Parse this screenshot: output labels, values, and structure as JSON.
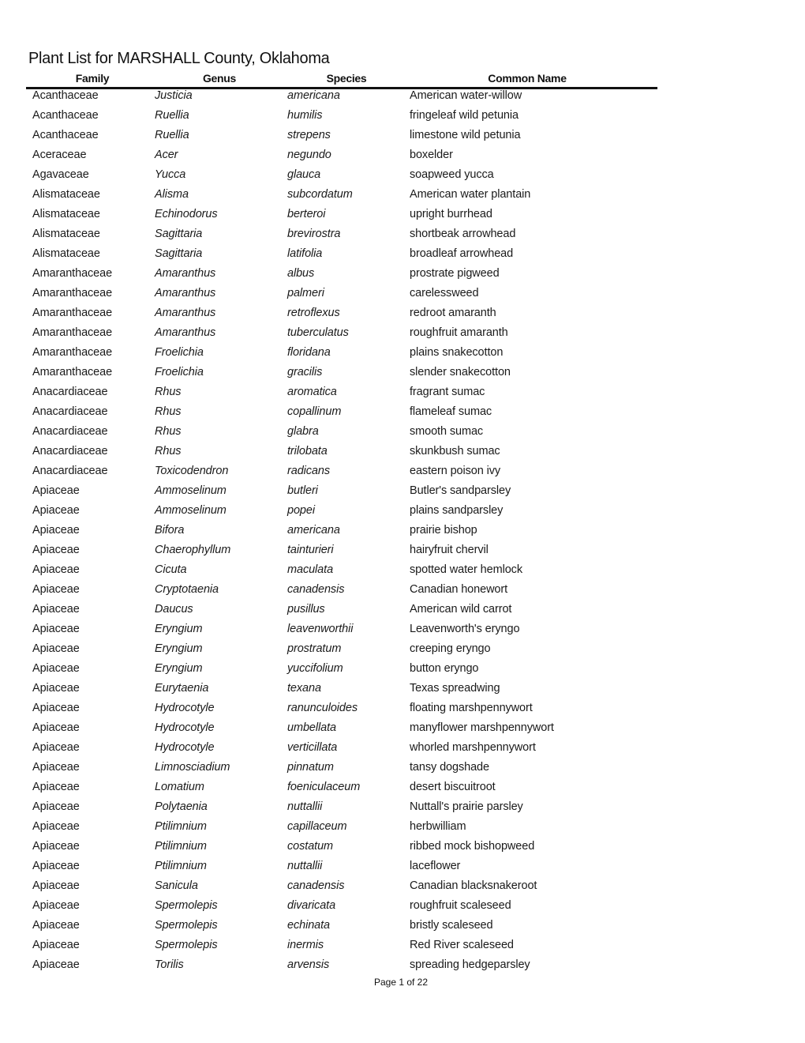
{
  "document": {
    "title": "Plant List for MARSHALL County, Oklahoma",
    "columns": {
      "family": "Family",
      "genus": "Genus",
      "species": "Species",
      "common_name": "Common Name"
    },
    "rows": [
      {
        "family": "Acanthaceae",
        "genus": "Justicia",
        "species": "americana",
        "common_name": "American water-willow"
      },
      {
        "family": "Acanthaceae",
        "genus": "Ruellia",
        "species": "humilis",
        "common_name": "fringeleaf wild petunia"
      },
      {
        "family": "Acanthaceae",
        "genus": "Ruellia",
        "species": "strepens",
        "common_name": "limestone wild petunia"
      },
      {
        "family": "Aceraceae",
        "genus": "Acer",
        "species": "negundo",
        "common_name": "boxelder"
      },
      {
        "family": "Agavaceae",
        "genus": "Yucca",
        "species": "glauca",
        "common_name": "soapweed yucca"
      },
      {
        "family": "Alismataceae",
        "genus": "Alisma",
        "species": "subcordatum",
        "common_name": "American water plantain"
      },
      {
        "family": "Alismataceae",
        "genus": "Echinodorus",
        "species": "berteroi",
        "common_name": "upright burrhead"
      },
      {
        "family": "Alismataceae",
        "genus": "Sagittaria",
        "species": "brevirostra",
        "common_name": "shortbeak arrowhead"
      },
      {
        "family": "Alismataceae",
        "genus": "Sagittaria",
        "species": "latifolia",
        "common_name": "broadleaf arrowhead"
      },
      {
        "family": "Amaranthaceae",
        "genus": "Amaranthus",
        "species": "albus",
        "common_name": "prostrate pigweed"
      },
      {
        "family": "Amaranthaceae",
        "genus": "Amaranthus",
        "species": "palmeri",
        "common_name": "carelessweed"
      },
      {
        "family": "Amaranthaceae",
        "genus": "Amaranthus",
        "species": "retroflexus",
        "common_name": "redroot amaranth"
      },
      {
        "family": "Amaranthaceae",
        "genus": "Amaranthus",
        "species": "tuberculatus",
        "common_name": "roughfruit amaranth"
      },
      {
        "family": "Amaranthaceae",
        "genus": "Froelichia",
        "species": "floridana",
        "common_name": "plains snakecotton"
      },
      {
        "family": "Amaranthaceae",
        "genus": "Froelichia",
        "species": "gracilis",
        "common_name": "slender snakecotton"
      },
      {
        "family": "Anacardiaceae",
        "genus": "Rhus",
        "species": "aromatica",
        "common_name": "fragrant sumac"
      },
      {
        "family": "Anacardiaceae",
        "genus": "Rhus",
        "species": "copallinum",
        "common_name": "flameleaf sumac"
      },
      {
        "family": "Anacardiaceae",
        "genus": "Rhus",
        "species": "glabra",
        "common_name": "smooth sumac"
      },
      {
        "family": "Anacardiaceae",
        "genus": "Rhus",
        "species": "trilobata",
        "common_name": "skunkbush sumac"
      },
      {
        "family": "Anacardiaceae",
        "genus": "Toxicodendron",
        "species": "radicans",
        "common_name": "eastern poison ivy"
      },
      {
        "family": "Apiaceae",
        "genus": "Ammoselinum",
        "species": "butleri",
        "common_name": "Butler's sandparsley"
      },
      {
        "family": "Apiaceae",
        "genus": "Ammoselinum",
        "species": "popei",
        "common_name": "plains sandparsley"
      },
      {
        "family": "Apiaceae",
        "genus": "Bifora",
        "species": "americana",
        "common_name": "prairie bishop"
      },
      {
        "family": "Apiaceae",
        "genus": "Chaerophyllum",
        "species": "tainturieri",
        "common_name": "hairyfruit chervil"
      },
      {
        "family": "Apiaceae",
        "genus": "Cicuta",
        "species": "maculata",
        "common_name": "spotted water hemlock"
      },
      {
        "family": "Apiaceae",
        "genus": "Cryptotaenia",
        "species": "canadensis",
        "common_name": "Canadian honewort"
      },
      {
        "family": "Apiaceae",
        "genus": "Daucus",
        "species": "pusillus",
        "common_name": "American wild carrot"
      },
      {
        "family": "Apiaceae",
        "genus": "Eryngium",
        "species": "leavenworthii",
        "common_name": "Leavenworth's eryngo"
      },
      {
        "family": "Apiaceae",
        "genus": "Eryngium",
        "species": "prostratum",
        "common_name": "creeping eryngo"
      },
      {
        "family": "Apiaceae",
        "genus": "Eryngium",
        "species": "yuccifolium",
        "common_name": "button eryngo"
      },
      {
        "family": "Apiaceae",
        "genus": "Eurytaenia",
        "species": "texana",
        "common_name": "Texas spreadwing"
      },
      {
        "family": "Apiaceae",
        "genus": "Hydrocotyle",
        "species": "ranunculoides",
        "common_name": "floating marshpennywort"
      },
      {
        "family": "Apiaceae",
        "genus": "Hydrocotyle",
        "species": "umbellata",
        "common_name": "manyflower marshpennywort"
      },
      {
        "family": "Apiaceae",
        "genus": "Hydrocotyle",
        "species": "verticillata",
        "common_name": "whorled marshpennywort"
      },
      {
        "family": "Apiaceae",
        "genus": "Limnosciadium",
        "species": "pinnatum",
        "common_name": "tansy dogshade"
      },
      {
        "family": "Apiaceae",
        "genus": "Lomatium",
        "species": "foeniculaceum",
        "common_name": "desert biscuitroot"
      },
      {
        "family": "Apiaceae",
        "genus": "Polytaenia",
        "species": "nuttallii",
        "common_name": "Nuttall's prairie parsley"
      },
      {
        "family": "Apiaceae",
        "genus": "Ptilimnium",
        "species": "capillaceum",
        "common_name": "herbwilliam"
      },
      {
        "family": "Apiaceae",
        "genus": "Ptilimnium",
        "species": "costatum",
        "common_name": "ribbed mock bishopweed"
      },
      {
        "family": "Apiaceae",
        "genus": "Ptilimnium",
        "species": "nuttallii",
        "common_name": "laceflower"
      },
      {
        "family": "Apiaceae",
        "genus": "Sanicula",
        "species": "canadensis",
        "common_name": "Canadian blacksnakeroot"
      },
      {
        "family": "Apiaceae",
        "genus": "Spermolepis",
        "species": "divaricata",
        "common_name": "roughfruit scaleseed"
      },
      {
        "family": "Apiaceae",
        "genus": "Spermolepis",
        "species": "echinata",
        "common_name": "bristly scaleseed"
      },
      {
        "family": "Apiaceae",
        "genus": "Spermolepis",
        "species": "inermis",
        "common_name": "Red River scaleseed"
      },
      {
        "family": "Apiaceae",
        "genus": "Torilis",
        "species": "arvensis",
        "common_name": "spreading hedgeparsley"
      }
    ],
    "footer": {
      "page_label": "Page 1 of 22"
    }
  }
}
